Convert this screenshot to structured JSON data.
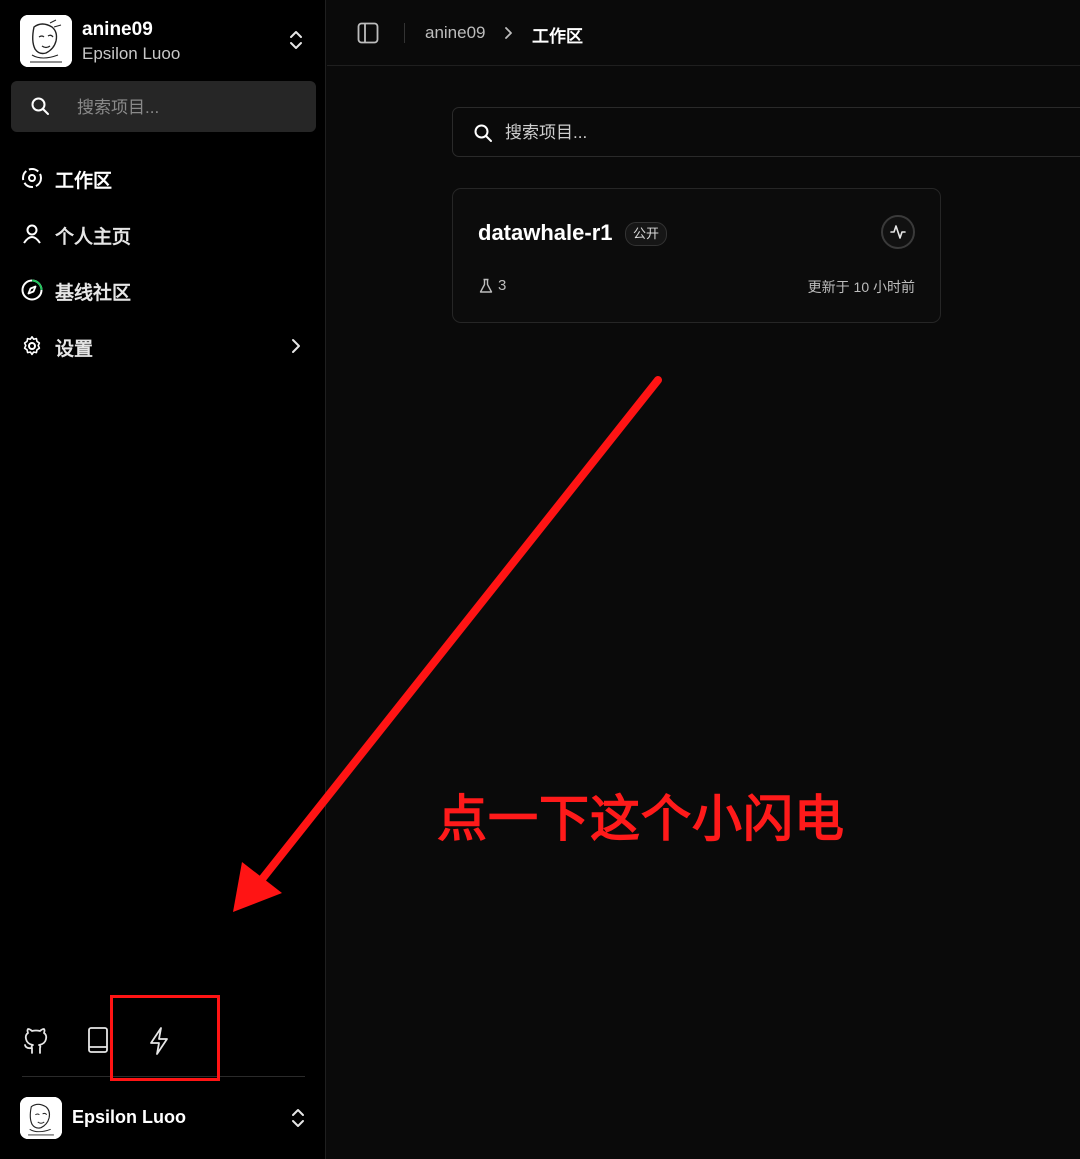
{
  "account": {
    "username": "anine09",
    "display_name": "Epsilon Luoo"
  },
  "sidebar": {
    "search_placeholder": "搜索项目...",
    "nav": [
      {
        "label": "工作区",
        "icon": "workspace-icon",
        "active": true
      },
      {
        "label": "个人主页",
        "icon": "user-icon"
      },
      {
        "label": "基线社区",
        "icon": "compass-icon"
      },
      {
        "label": "设置",
        "icon": "gear-icon"
      }
    ],
    "tools": [
      "github-icon",
      "book-icon",
      "lightning-icon"
    ],
    "footer_account": {
      "display_name": "Epsilon Luoo"
    }
  },
  "breadcrumb": {
    "user": "anine09",
    "current": "工作区"
  },
  "main": {
    "search_placeholder": "搜索项目...",
    "project": {
      "name": "datawhale-r1",
      "visibility": "公开",
      "experiments": "3",
      "updated": "更新于 10 小时前"
    }
  },
  "annotation": {
    "text": "点一下这个小闪电",
    "color": "#ff1a1a"
  },
  "colors": {
    "background": "#0a0a0a",
    "sidebar": "#000000",
    "annotation": "#ff1414"
  }
}
